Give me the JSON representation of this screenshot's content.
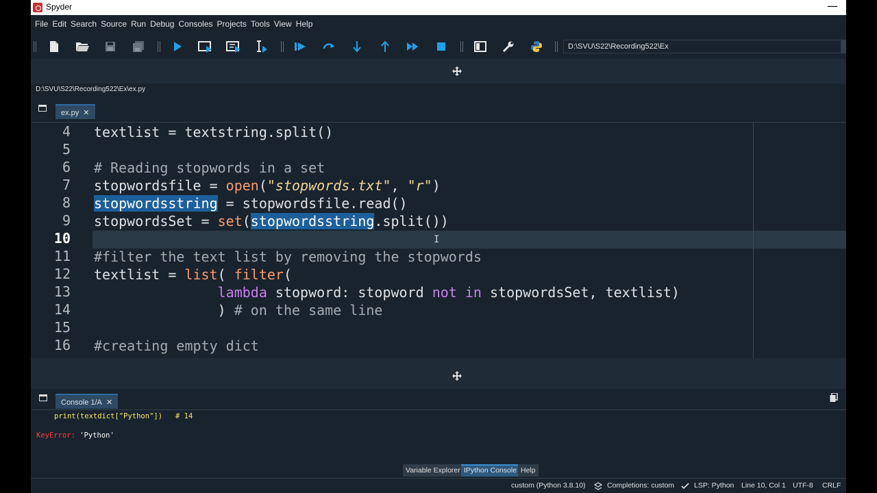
{
  "window": {
    "title": "Spyder"
  },
  "menu": [
    "File",
    "Edit",
    "Search",
    "Source",
    "Run",
    "Debug",
    "Consoles",
    "Projects",
    "Tools",
    "View",
    "Help"
  ],
  "toolbar": {
    "path": "D:\\SVU\\S22\\Recording522\\Ex"
  },
  "editor": {
    "file_path": "D:\\SVU\\S22\\Recording522\\Ex\\ex.py",
    "tab_label": "ex.py",
    "current_line": 10,
    "line_numbers": [
      "4",
      "5",
      "6",
      "7",
      "8",
      "9",
      "10",
      "11",
      "12",
      "13",
      "14",
      "15",
      "16"
    ],
    "code": {
      "l4_a": "textlist = textstring.split()",
      "l6_a": "# Reading stopwords in a set",
      "l7_a": "stopwordsfile = ",
      "l7_b": "open",
      "l7_c": "(",
      "l7_d": "\"stopwords.txt\"",
      "l7_e": ", ",
      "l7_f": "\"r\"",
      "l7_g": ")",
      "l8_a": "stopwordsstring",
      "l8_b": " = stopwordsfile.read()",
      "l9_a": "stopwordsSet = ",
      "l9_b": "set",
      "l9_c": "(",
      "l9_d": "stopwordsstring",
      "l9_e": ".split())",
      "l11_a": "#filter the text list by removing the stopwords",
      "l12_a": "textlist = ",
      "l12_b": "list",
      "l12_c": "( ",
      "l12_d": "filter",
      "l12_e": "(",
      "l13_indent": "               ",
      "l13_a": "lambda",
      "l13_b": " stopword: stopword ",
      "l13_c": "not",
      "l13_d": " ",
      "l13_e": "in",
      "l13_f": " stopwordsSet, textlist)",
      "l14_a": "               ) ",
      "l14_b": "# on the same line",
      "l16_a": "#creating empty dict"
    }
  },
  "console": {
    "tab_label": "Console 1/A",
    "input_line": "print(textdict[\"Python\"])   # 14",
    "error_name": "KeyError:",
    "error_message": " 'Python'"
  },
  "bottom_tabs": [
    "Variable Explorer",
    "IPython Console",
    "Help"
  ],
  "status": {
    "env": "custom (Python 3.8.10)",
    "completions": "Completions: custom",
    "lsp": "LSP: Python",
    "position": "Line 10, Col 1",
    "encoding": "UTF-8",
    "eol": "CRLF"
  },
  "colors": {
    "background": "#19232d",
    "builtin": "#f89c6b",
    "string": "#f0d69c",
    "keyword": "#c882ec",
    "comment": "#a5acb3",
    "selection": "#1d5f9b",
    "run_blue": "#1e90ff"
  }
}
